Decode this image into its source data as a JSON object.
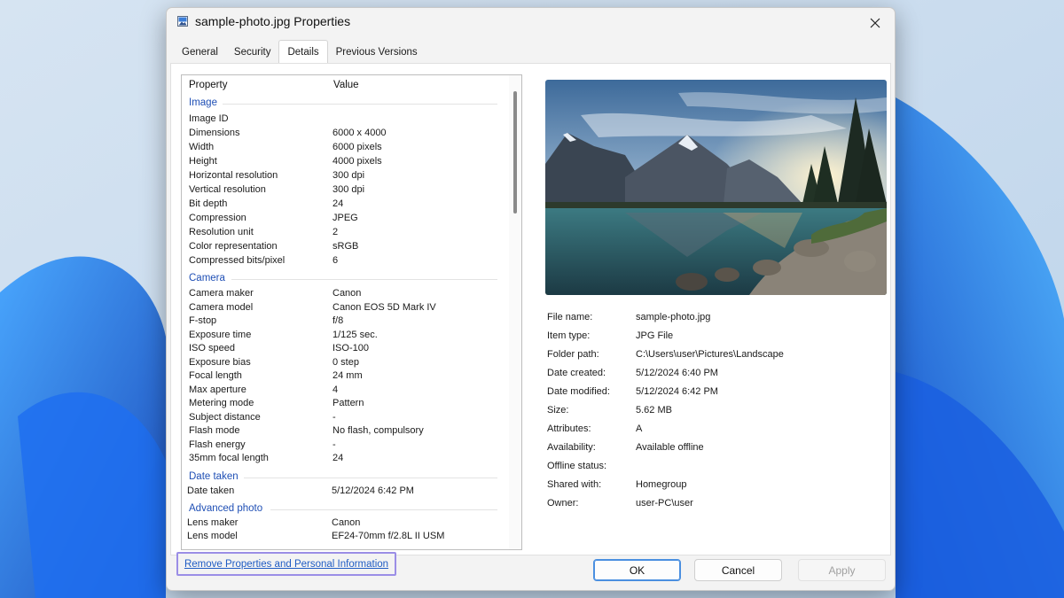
{
  "dialog": {
    "title": "sample-photo.jpg Properties",
    "close_icon": "close-icon",
    "tabs": [
      {
        "label": "General",
        "active": false
      },
      {
        "label": "Security",
        "active": false
      },
      {
        "label": "Details",
        "active": true
      },
      {
        "label": "Previous Versions",
        "active": false
      }
    ]
  },
  "details": {
    "header": {
      "property": "Property",
      "value": "Value"
    },
    "groups": {
      "image": {
        "label": "Image",
        "rows": [
          {
            "name": "Image ID",
            "value": ""
          },
          {
            "name": "Dimensions",
            "value": "6000 x 4000"
          },
          {
            "name": "Width",
            "value": "6000 pixels"
          },
          {
            "name": "Height",
            "value": "4000 pixels"
          },
          {
            "name": "Horizontal resolution",
            "value": "300 dpi"
          },
          {
            "name": "Vertical resolution",
            "value": "300 dpi"
          },
          {
            "name": "Bit depth",
            "value": "24"
          },
          {
            "name": "Compression",
            "value": "JPEG"
          },
          {
            "name": "Resolution unit",
            "value": "2"
          },
          {
            "name": "Color representation",
            "value": "sRGB"
          },
          {
            "name": "Compressed bits/pixel",
            "value": "6"
          }
        ]
      },
      "camera": {
        "label": "Camera",
        "rows": [
          {
            "name": "Camera maker",
            "value": "Canon"
          },
          {
            "name": "Camera model",
            "value": "Canon EOS 5D Mark IV"
          },
          {
            "name": "F-stop",
            "value": "f/8"
          },
          {
            "name": "Exposure time",
            "value": "1/125 sec."
          },
          {
            "name": "ISO speed",
            "value": "ISO-100"
          },
          {
            "name": "Exposure bias",
            "value": "0 step"
          },
          {
            "name": "Focal length",
            "value": "24 mm"
          },
          {
            "name": "Max aperture",
            "value": "4"
          },
          {
            "name": "Metering mode",
            "value": "Pattern"
          },
          {
            "name": "Subject distance",
            "value": "-"
          },
          {
            "name": "Flash mode",
            "value": "No flash, compulsory"
          },
          {
            "name": "Flash energy",
            "value": "-"
          },
          {
            "name": "35mm focal length",
            "value": "24"
          }
        ]
      },
      "date_taken": {
        "label": "Date taken",
        "rows": [
          {
            "name": "Date taken",
            "value": "5/12/2024 6:42 PM"
          }
        ]
      },
      "advanced_photo": {
        "label": "Advanced photo",
        "rows": [
          {
            "name": "Lens maker",
            "value": "Canon"
          },
          {
            "name": "Lens model",
            "value": "EF24-70mm f/2.8L II USM"
          }
        ]
      }
    }
  },
  "file_info": [
    {
      "label": "File name:",
      "value": "sample-photo.jpg"
    },
    {
      "label": "Item type:",
      "value": "JPG File"
    },
    {
      "label": "Folder path:",
      "value": "C:\\Users\\user\\Pictures\\Landscape"
    },
    {
      "label": "Date created:",
      "value": "5/12/2024 6:40 PM"
    },
    {
      "label": "Date modified:",
      "value": "5/12/2024 6:42 PM"
    },
    {
      "label": "Size:",
      "value": "5.62 MB"
    },
    {
      "label": "Attributes:",
      "value": "A"
    },
    {
      "label": "Availability:",
      "value": "Available offline"
    },
    {
      "label": "Offline status:",
      "value": ""
    },
    {
      "label": "Shared with:",
      "value": "Homegroup"
    },
    {
      "label": "Owner:",
      "value": "user-PC\\user"
    }
  ],
  "footer": {
    "remove_link": "Remove Properties and Personal Information",
    "ok": "OK",
    "cancel": "Cancel",
    "apply": "Apply"
  },
  "colors": {
    "accent": "#1f5cc4",
    "group_label": "#1f4fb5",
    "focus_outline": "#9b8ee6"
  }
}
